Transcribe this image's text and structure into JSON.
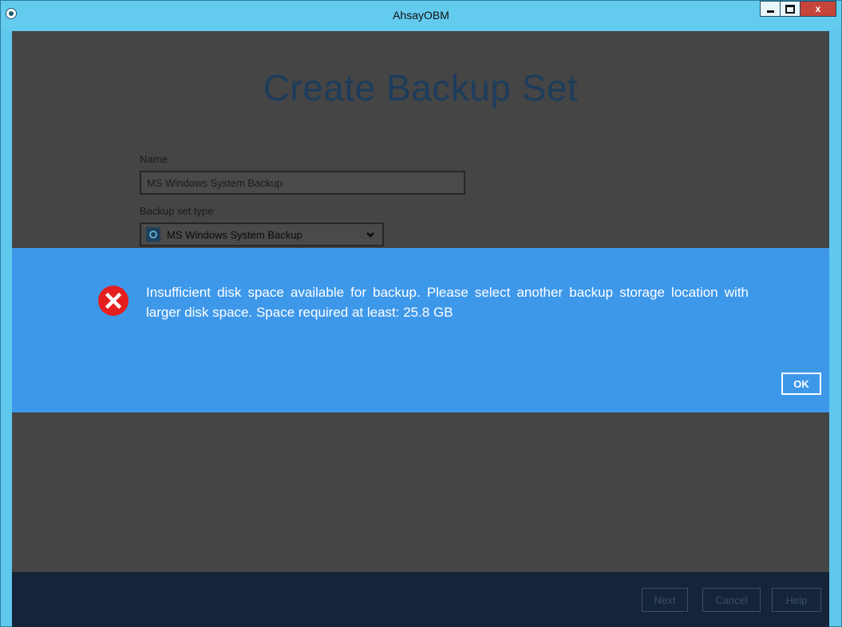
{
  "window": {
    "title": "AhsayOBM",
    "controls": {
      "minimize": "minimize",
      "maximize": "maximize",
      "close": "x"
    }
  },
  "page": {
    "heading": "Create Backup Set",
    "name_label": "Name",
    "name_value": "MS Windows System Backup",
    "type_label": "Backup set type",
    "type_value": "MS Windows System Backup"
  },
  "dialog": {
    "message": "Insufficient disk space available for backup. Please select another backup storage location with larger disk space. Space required at least: 25.8 GB",
    "error_glyph": "X",
    "ok_label": "OK"
  },
  "footer": {
    "next_label": "Next",
    "cancel_label": "Cancel",
    "help_label": "Help"
  },
  "colors": {
    "titlebar": "#63cbee",
    "overlay": "#454545",
    "dialog": "#3e98ea",
    "error": "#e51f1f",
    "footer": "#14253a"
  }
}
